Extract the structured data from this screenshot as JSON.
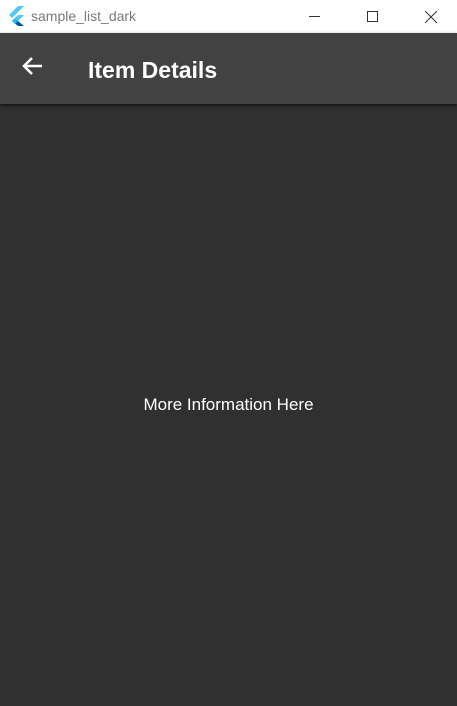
{
  "window": {
    "title": "sample_list_dark",
    "controls": {
      "minimize_icon": "minimize-icon",
      "maximize_icon": "maximize-icon",
      "close_icon": "close-icon"
    },
    "logo_icon": "flutter-logo-icon"
  },
  "appbar": {
    "back_icon": "arrow-back-icon",
    "title": "Item Details"
  },
  "content": {
    "text": "More Information Here"
  },
  "colors": {
    "titlebar_bg": "#ffffff",
    "appbar_bg": "#424242",
    "body_bg": "#303030",
    "text_primary": "#ffffff",
    "flutter_light_blue": "#54c5f8",
    "flutter_dark_blue": "#01579b"
  }
}
